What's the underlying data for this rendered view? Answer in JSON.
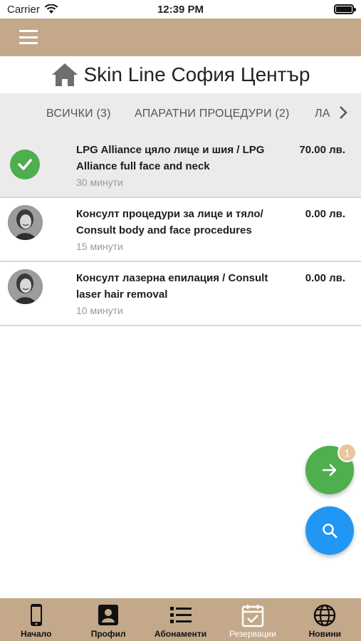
{
  "status_bar": {
    "carrier": "Carrier",
    "time": "12:39 PM",
    "battery_level": 1.0
  },
  "title": {
    "text": "Skin Line София Център",
    "icon": "home-icon"
  },
  "tabs": [
    {
      "label": "ВСИЧКИ (3)"
    },
    {
      "label": "АПАРАТНИ ПРОЦЕДУРИ (2)"
    },
    {
      "label": "ЛА"
    }
  ],
  "services": [
    {
      "title": "LPG Alliance цяло лице и шия / LPG Alliance full face and neck",
      "price": "70.00 лв.",
      "duration": "30 минути",
      "selected": true,
      "icon": "check-icon"
    },
    {
      "title": "Консулт процедури за лице и тяло/ Consult body and face procedures",
      "price": "0.00 лв.",
      "duration": "15 минути",
      "selected": false,
      "icon": "avatar"
    },
    {
      "title": "Консулт лазерна епилация / Consult laser hair removal",
      "price": "0.00 лв.",
      "duration": "10 минути",
      "selected": false,
      "icon": "avatar"
    }
  ],
  "fab": {
    "next_badge": "1",
    "next_icon": "arrow-right-icon",
    "search_icon": "search-icon"
  },
  "bottom_nav": [
    {
      "label": "Начало",
      "icon": "phone-icon"
    },
    {
      "label": "Профил",
      "icon": "profile-icon"
    },
    {
      "label": "Абонаменти",
      "icon": "list-icon"
    },
    {
      "label": "Резервации",
      "icon": "calendar-check-icon",
      "active": true
    },
    {
      "label": "Новини",
      "icon": "globe-icon"
    }
  ],
  "colors": {
    "brand": "#c3a98a",
    "green": "#4fae4e",
    "blue": "#2196f3",
    "badge": "#e8c6a0"
  }
}
